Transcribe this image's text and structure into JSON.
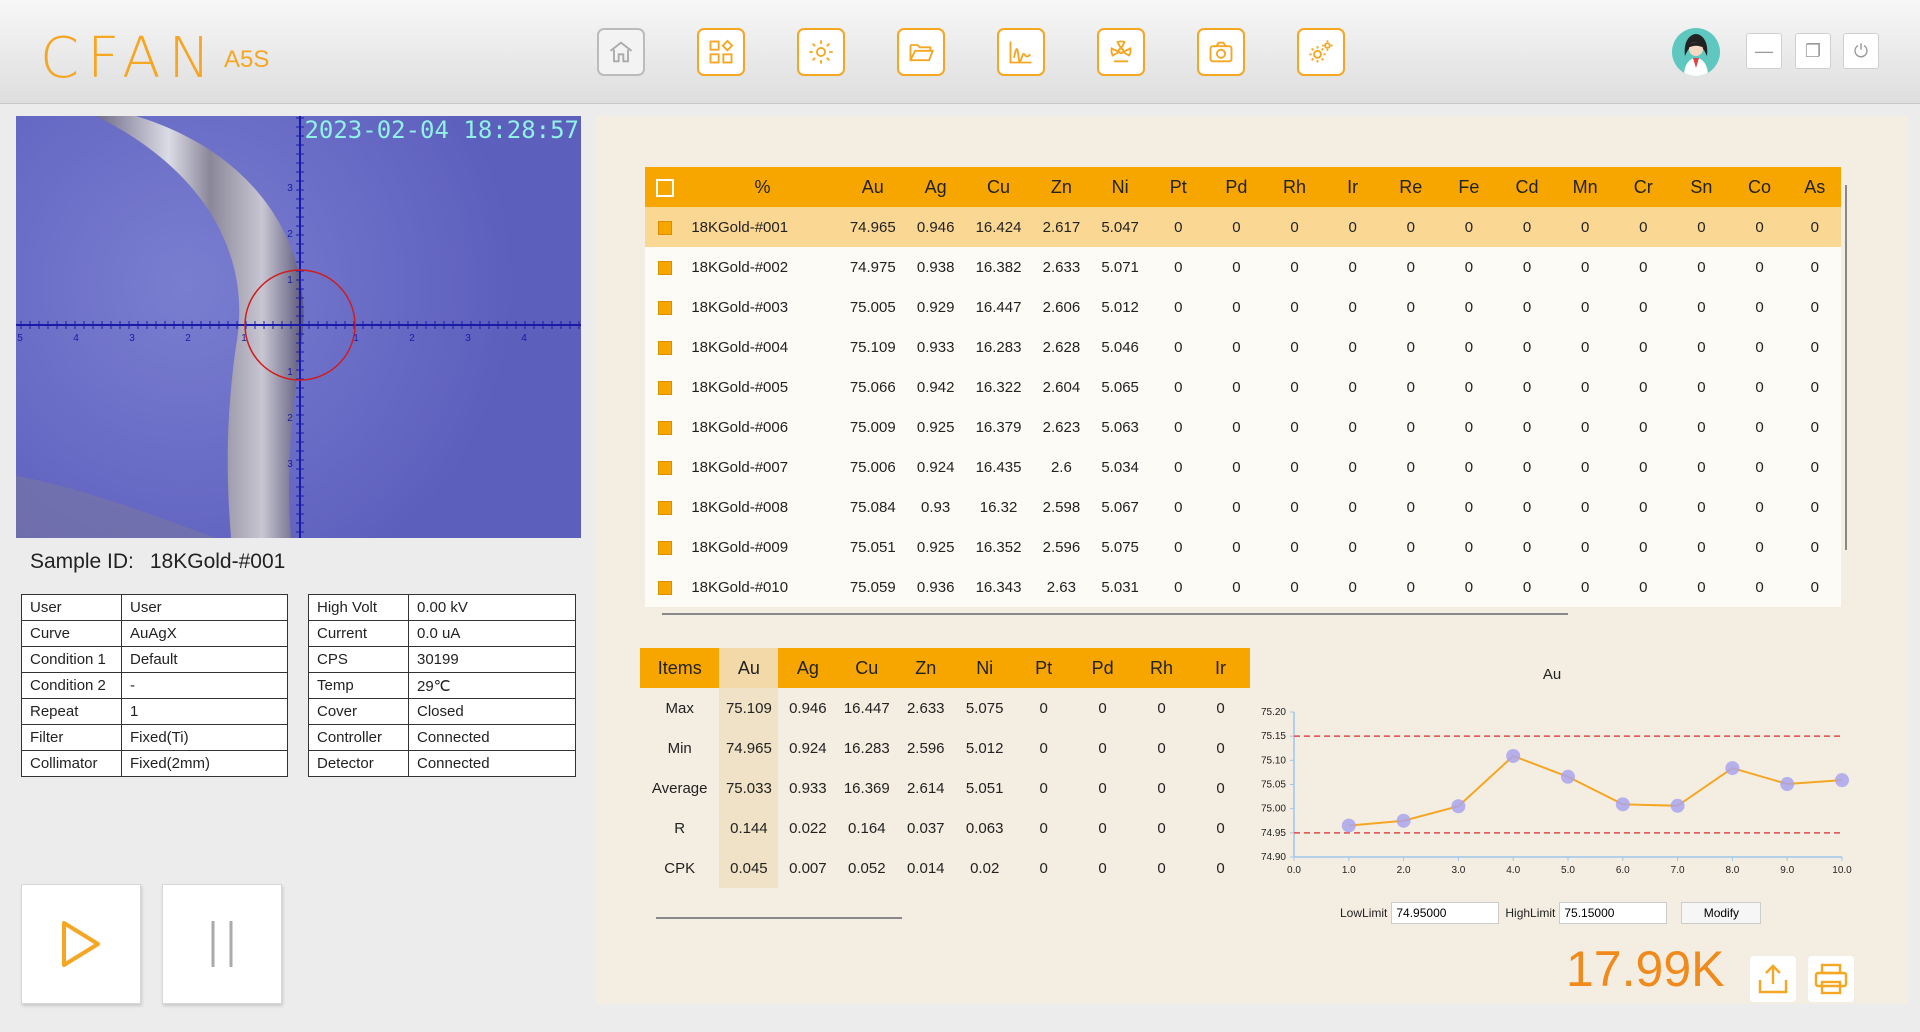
{
  "header": {
    "logo": "CFAN",
    "model": "A5S",
    "nav": [
      {
        "icon": "home-icon",
        "enabled": false
      },
      {
        "icon": "apps-icon",
        "enabled": true
      },
      {
        "icon": "settings-icon",
        "enabled": true
      },
      {
        "icon": "folder-open-icon",
        "enabled": true
      },
      {
        "icon": "spectrum-chart-icon",
        "enabled": true
      },
      {
        "icon": "radiation-icon",
        "enabled": true
      },
      {
        "icon": "camera-icon",
        "enabled": true
      },
      {
        "icon": "advanced-settings-icon",
        "enabled": true
      }
    ],
    "window_controls": {
      "minimize": "—",
      "restore": "❐",
      "power": "⏻"
    }
  },
  "camera": {
    "timestamp": "2023-02-04  18:28:57",
    "ticks": [
      "5",
      "4",
      "3",
      "2",
      "1",
      "1",
      "2",
      "3",
      "4"
    ],
    "vticks": [
      "3",
      "2",
      "1",
      "1",
      "2",
      "3"
    ]
  },
  "sample": {
    "label": "Sample ID:",
    "value": "18KGold-#001"
  },
  "info_left": [
    [
      "User",
      "User"
    ],
    [
      "Curve",
      "AuAgX"
    ],
    [
      "Condition 1",
      "Default"
    ],
    [
      "Condition 2",
      "-"
    ],
    [
      "Repeat",
      "1"
    ],
    [
      "Filter",
      "Fixed(Ti)"
    ],
    [
      "Collimator",
      "Fixed(2mm)"
    ]
  ],
  "info_right": [
    [
      "High Volt",
      "0.00 kV"
    ],
    [
      "Current",
      "0.0 uA"
    ],
    [
      "CPS",
      "30199"
    ],
    [
      "Temp",
      "29℃"
    ],
    [
      "Cover",
      "Closed"
    ],
    [
      "Controller",
      "Connected"
    ],
    [
      "Detector",
      "Connected"
    ]
  ],
  "results": {
    "headers": [
      "%",
      "Au",
      "Ag",
      "Cu",
      "Zn",
      "Ni",
      "Pt",
      "Pd",
      "Rh",
      "Ir",
      "Re",
      "Fe",
      "Cd",
      "Mn",
      "Cr",
      "Sn",
      "Co",
      "As"
    ],
    "rows": [
      [
        "18KGold-#001",
        "74.965",
        "0.946",
        "16.424",
        "2.617",
        "5.047",
        "0",
        "0",
        "0",
        "0",
        "0",
        "0",
        "0",
        "0",
        "0",
        "0",
        "0",
        "0"
      ],
      [
        "18KGold-#002",
        "74.975",
        "0.938",
        "16.382",
        "2.633",
        "5.071",
        "0",
        "0",
        "0",
        "0",
        "0",
        "0",
        "0",
        "0",
        "0",
        "0",
        "0",
        "0"
      ],
      [
        "18KGold-#003",
        "75.005",
        "0.929",
        "16.447",
        "2.606",
        "5.012",
        "0",
        "0",
        "0",
        "0",
        "0",
        "0",
        "0",
        "0",
        "0",
        "0",
        "0",
        "0"
      ],
      [
        "18KGold-#004",
        "75.109",
        "0.933",
        "16.283",
        "2.628",
        "5.046",
        "0",
        "0",
        "0",
        "0",
        "0",
        "0",
        "0",
        "0",
        "0",
        "0",
        "0",
        "0"
      ],
      [
        "18KGold-#005",
        "75.066",
        "0.942",
        "16.322",
        "2.604",
        "5.065",
        "0",
        "0",
        "0",
        "0",
        "0",
        "0",
        "0",
        "0",
        "0",
        "0",
        "0",
        "0"
      ],
      [
        "18KGold-#006",
        "75.009",
        "0.925",
        "16.379",
        "2.623",
        "5.063",
        "0",
        "0",
        "0",
        "0",
        "0",
        "0",
        "0",
        "0",
        "0",
        "0",
        "0",
        "0"
      ],
      [
        "18KGold-#007",
        "75.006",
        "0.924",
        "16.435",
        "2.6",
        "5.034",
        "0",
        "0",
        "0",
        "0",
        "0",
        "0",
        "0",
        "0",
        "0",
        "0",
        "0",
        "0"
      ],
      [
        "18KGold-#008",
        "75.084",
        "0.93",
        "16.32",
        "2.598",
        "5.067",
        "0",
        "0",
        "0",
        "0",
        "0",
        "0",
        "0",
        "0",
        "0",
        "0",
        "0",
        "0"
      ],
      [
        "18KGold-#009",
        "75.051",
        "0.925",
        "16.352",
        "2.596",
        "5.075",
        "0",
        "0",
        "0",
        "0",
        "0",
        "0",
        "0",
        "0",
        "0",
        "0",
        "0",
        "0"
      ],
      [
        "18KGold-#010",
        "75.059",
        "0.936",
        "16.343",
        "2.63",
        "5.031",
        "0",
        "0",
        "0",
        "0",
        "0",
        "0",
        "0",
        "0",
        "0",
        "0",
        "0",
        "0"
      ]
    ]
  },
  "stats": {
    "headers": [
      "Items",
      "Au",
      "Ag",
      "Cu",
      "Zn",
      "Ni",
      "Pt",
      "Pd",
      "Rh",
      "Ir"
    ],
    "rows": [
      [
        "Max",
        "75.109",
        "0.946",
        "16.447",
        "2.633",
        "5.075",
        "0",
        "0",
        "0",
        "0"
      ],
      [
        "Min",
        "74.965",
        "0.924",
        "16.283",
        "2.596",
        "5.012",
        "0",
        "0",
        "0",
        "0"
      ],
      [
        "Average",
        "75.033",
        "0.933",
        "16.369",
        "2.614",
        "5.051",
        "0",
        "0",
        "0",
        "0"
      ],
      [
        "R",
        "0.144",
        "0.022",
        "0.164",
        "0.037",
        "0.063",
        "0",
        "0",
        "0",
        "0"
      ],
      [
        "CPK",
        "0.045",
        "0.007",
        "0.052",
        "0.014",
        "0.02",
        "0",
        "0",
        "0",
        "0"
      ]
    ]
  },
  "chart_data": {
    "type": "line",
    "title": "Au",
    "x": [
      1,
      2,
      3,
      4,
      5,
      6,
      7,
      8,
      9,
      10
    ],
    "values": [
      74.965,
      74.975,
      75.005,
      75.109,
      75.066,
      75.009,
      75.006,
      75.084,
      75.051,
      75.059
    ],
    "xlim": [
      0,
      10
    ],
    "ylim": [
      74.9,
      75.2
    ],
    "xticks": [
      "0.0",
      "1.0",
      "2.0",
      "3.0",
      "4.0",
      "5.0",
      "6.0",
      "7.0",
      "8.0",
      "9.0",
      "10.0"
    ],
    "yticks": [
      "74.90",
      "74.95",
      "75.00",
      "75.05",
      "75.10",
      "75.15",
      "75.20"
    ],
    "low_limit": 74.95,
    "high_limit": 75.15,
    "line_color": "#f5a623",
    "marker_color": "#a9a4ec",
    "limit_color": "#e04a4a"
  },
  "limits": {
    "low_label": "LowLimit",
    "low_value": "74.95000",
    "high_label": "HighLimit",
    "high_value": "75.15000",
    "modify": "Modify"
  },
  "counter": "17.99K",
  "colors": {
    "accent": "#f7a600",
    "panel": "#f4eee2"
  }
}
